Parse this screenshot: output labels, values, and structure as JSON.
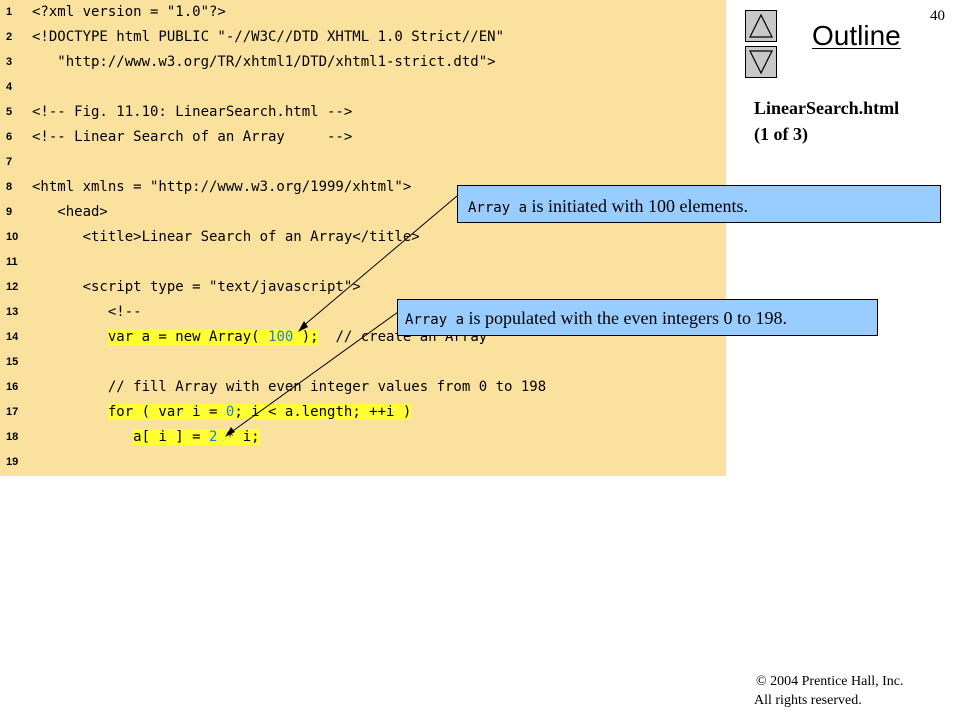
{
  "slide": {
    "page_number": "40",
    "outline_title": "Outline",
    "file_name": "LinearSearch.html",
    "file_part": "(1 of 3)",
    "copyright": "© 2004 Prentice Hall, Inc.",
    "rights": "All rights reserved."
  },
  "nav": {
    "up_icon": "triangle-up-icon",
    "down_icon": "triangle-down-icon"
  },
  "code": {
    "line_numbers": [
      "1",
      "2",
      "3",
      "4",
      "5",
      "6",
      "7",
      "8",
      "9",
      "10",
      "11",
      "12",
      "13",
      "14",
      "15",
      "16",
      "17",
      "18",
      "19"
    ],
    "line_1": "<?xml version = \"1.0\"?>",
    "line_2": "<!DOCTYPE html PUBLIC \"-//W3C//DTD XHTML 1.0 Strict//EN\"",
    "line_3": "   \"http://www.w3.org/TR/xhtml1/DTD/xhtml1-strict.dtd\">",
    "line_4": "",
    "line_5": "<!-- Fig. 11.10: LinearSearch.html -->",
    "line_6": "<!-- Linear Search of an Array     -->",
    "line_7": "",
    "line_8": "<html xmlns = \"http://www.w3.org/1999/xhtml\">",
    "line_9": "   <head>",
    "line_10": "      <title>Linear Search of an Array</title>",
    "line_11": "",
    "line_12": "      <script type = \"text/javascript\">",
    "line_13": "         <!--",
    "line_14a": "var a = new Array( ",
    "line_14num": "100",
    "line_14b": " );",
    "line_14c": "  // create an Array",
    "line_15": "",
    "line_16": "         // fill Array with even integer values from 0 to 198",
    "line_17a": "for ( var i = ",
    "line_17num": "0",
    "line_17b": "; i < a.length; ++i )",
    "line_18a": "a[ i ] = ",
    "line_18num": "2",
    "line_18b": " * i;",
    "line_19": ""
  },
  "callouts": {
    "first_code": "Array a",
    "first_text": " is initiated with 100 elements.",
    "second_code": "Array a",
    "second_text": " is populated with the even integers 0 to 198."
  },
  "colors": {
    "code_background": "#fae29e",
    "highlight": "#ffff33",
    "number": "#1f7fd6",
    "callout_background": "#99ccff",
    "nav_button": "#c8c8c8"
  }
}
